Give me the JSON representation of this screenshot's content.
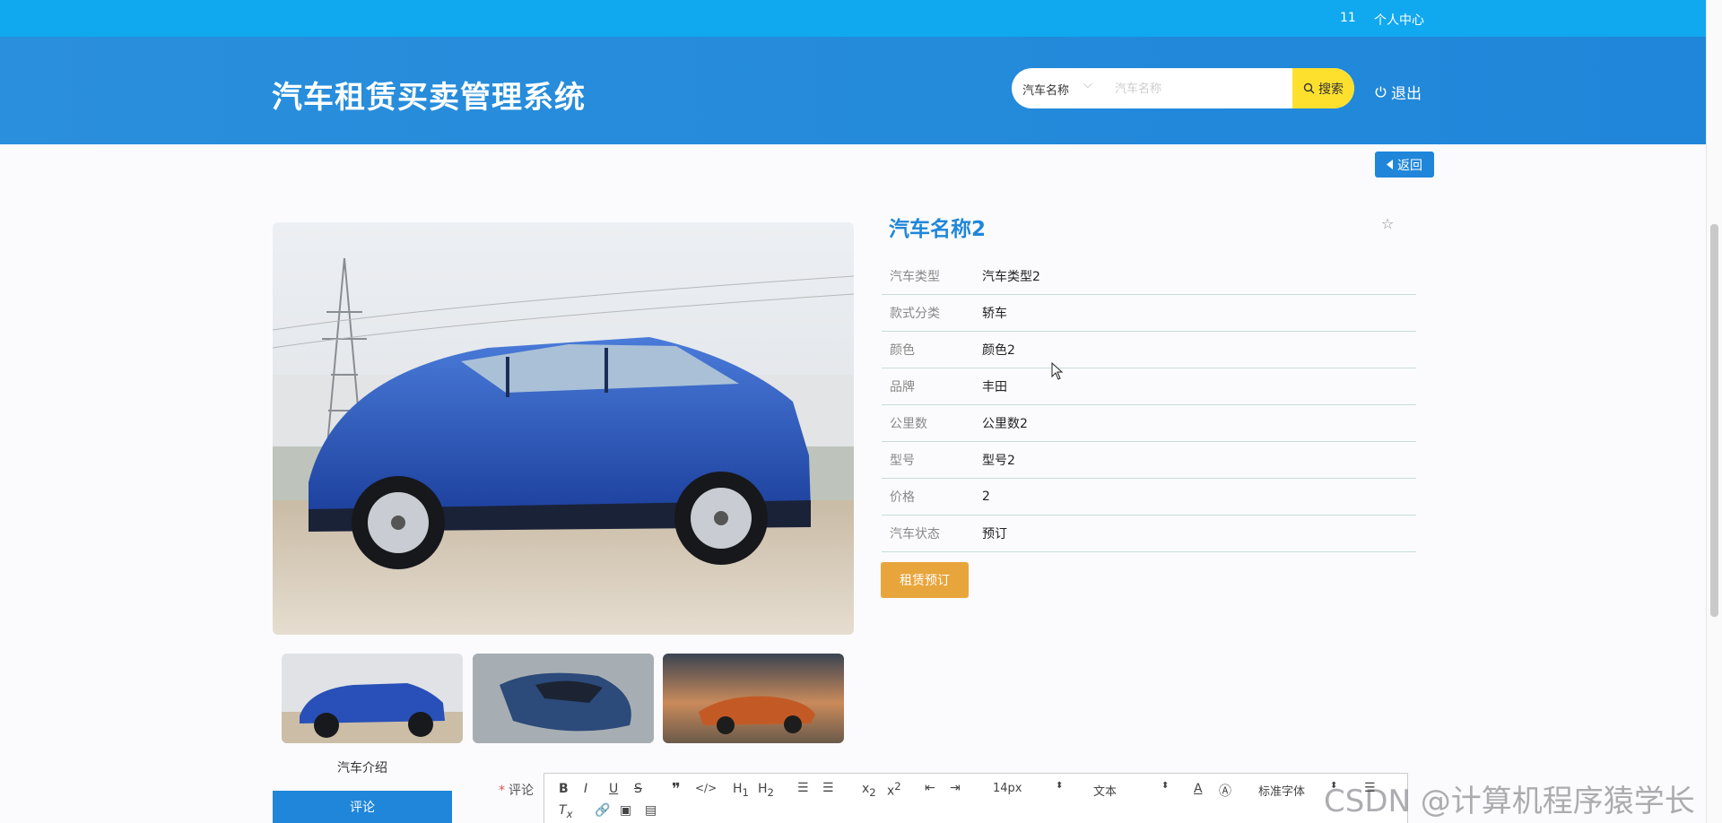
{
  "topbar": {
    "user_id": "11",
    "user_center": "个人中心"
  },
  "header": {
    "brand": "汽车租赁买卖管理系统",
    "search": {
      "field": "汽车名称",
      "placeholder": "汽车名称",
      "button": "搜索"
    },
    "logout": "退出"
  },
  "back_label": "返回",
  "car": {
    "name": "汽车名称2",
    "props": [
      {
        "k": "汽车类型",
        "v": "汽车类型2"
      },
      {
        "k": "款式分类",
        "v": "轿车"
      },
      {
        "k": "颜色",
        "v": "颜色2"
      },
      {
        "k": "品牌",
        "v": "丰田"
      },
      {
        "k": "公里数",
        "v": "公里数2"
      },
      {
        "k": "型号",
        "v": "型号2"
      },
      {
        "k": "价格",
        "v": "2"
      },
      {
        "k": "汽车状态",
        "v": "预订"
      }
    ],
    "rent_label": "租赁预订"
  },
  "tabs": {
    "intro": "汽车介绍",
    "comment": "评论"
  },
  "comment_form": {
    "label": "评论"
  },
  "editor": {
    "font_size": "14px",
    "block_type": "文本",
    "font_family": "标准字体"
  },
  "watermark": "CSDN @计算机程序猿学长",
  "icons": [
    "search-icon",
    "power-icon",
    "caret-left-icon",
    "star-icon"
  ]
}
